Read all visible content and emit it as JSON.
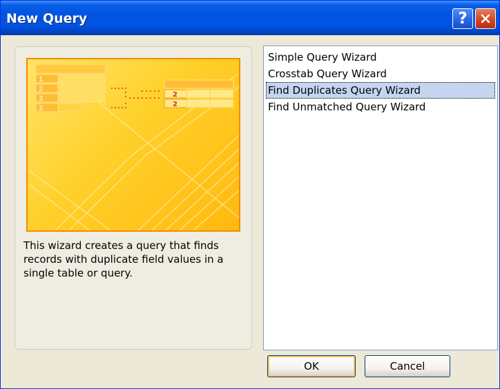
{
  "window": {
    "title": "New Query",
    "help_label": "?",
    "colors": {
      "titlebar": "#0054e3",
      "face": "#ece9d8",
      "selection": "#c5d5f0",
      "picture_border": "#f28c00"
    }
  },
  "illustration": {
    "left_rows": [
      "1",
      "2",
      "3",
      "2"
    ],
    "result_rows": [
      "2",
      "2"
    ]
  },
  "description": "This wizard creates a query that finds records with duplicate field values in a single table or query.",
  "wizards": [
    {
      "label": "Simple Query Wizard",
      "selected": false
    },
    {
      "label": "Crosstab Query Wizard",
      "selected": false
    },
    {
      "label": "Find Duplicates Query Wizard",
      "selected": true
    },
    {
      "label": "Find Unmatched Query Wizard",
      "selected": false
    }
  ],
  "buttons": {
    "ok": "OK",
    "cancel": "Cancel"
  }
}
